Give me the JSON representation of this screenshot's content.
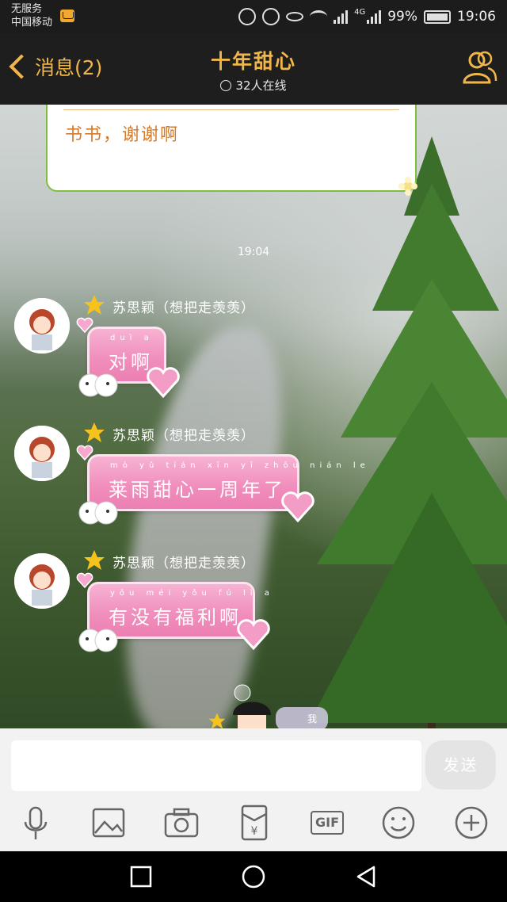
{
  "status_bar": {
    "carrier_line1": "无服务",
    "carrier_line2": "中国移动",
    "network": "4G",
    "battery_percent": "99%",
    "time": "19:06"
  },
  "header": {
    "back_label": "消息(2)",
    "title": "十年甜心",
    "online_status": "32人在线"
  },
  "chat": {
    "card_text": "书书，谢谢啊",
    "timestamp": "19:04",
    "messages": [
      {
        "sender": "苏思颖（想把走羡羡）",
        "pinyin": "duì a",
        "text": "对啊"
      },
      {
        "sender": "苏思颖（想把走羡羡）",
        "pinyin": "mò yǔ tián xīn yī zhōu nián le",
        "text": "莱雨甜心一周年了"
      },
      {
        "sender": "苏思颖（想把走羡羡）",
        "pinyin": "yǒu méi yǒu fú lì a",
        "text": "有没有福利啊"
      }
    ],
    "self_tag": "我"
  },
  "input": {
    "value": "",
    "send_label": "发送"
  },
  "toolbar": {
    "gif_label": "GIF"
  },
  "colors": {
    "accent": "#f0b64a",
    "bubble_pink": "#f08fbd",
    "card_border": "#7fbf3d"
  }
}
